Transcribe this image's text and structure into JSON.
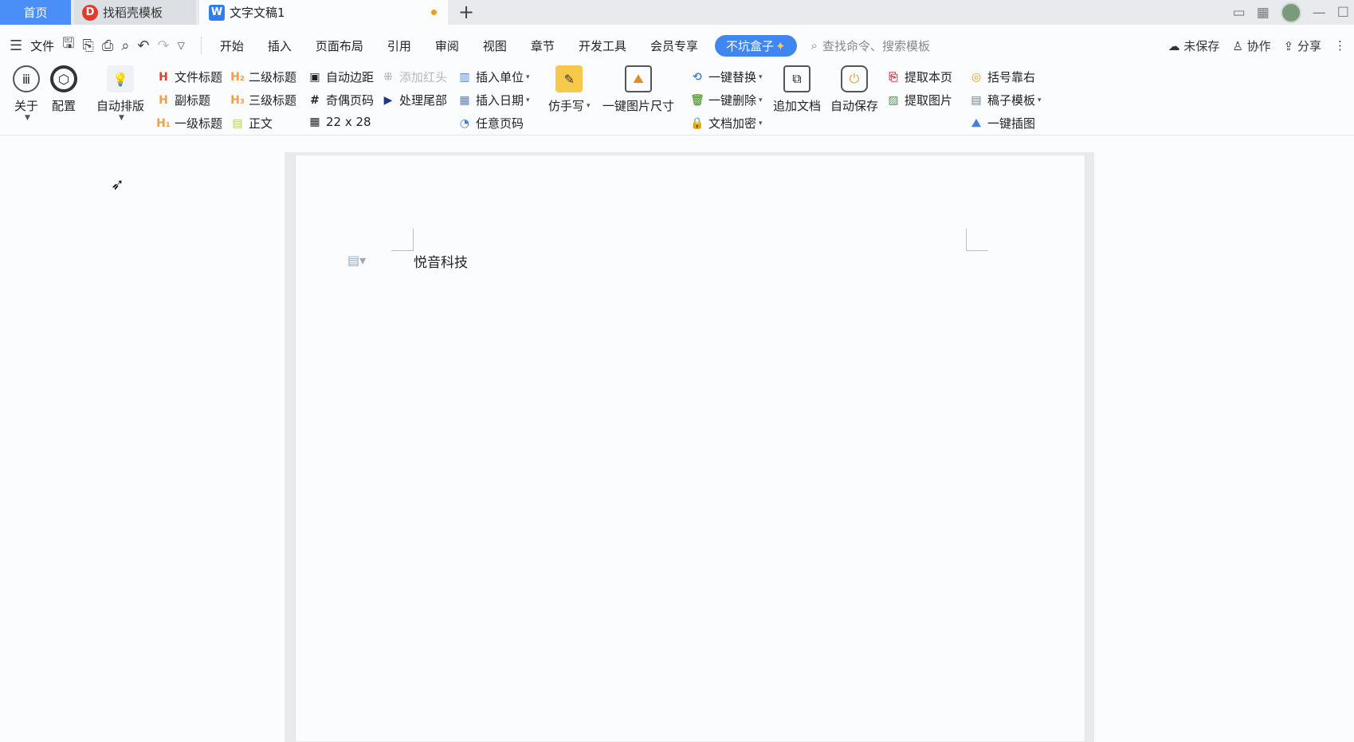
{
  "tabs": {
    "home": "首页",
    "template": "找稻壳模板",
    "document": "文字文稿1",
    "new_tab": "+"
  },
  "menu": {
    "file": "文件",
    "items": [
      "开始",
      "插入",
      "页面布局",
      "引用",
      "审阅",
      "视图",
      "章节",
      "开发工具",
      "会员专享"
    ],
    "active": "不坑盒子",
    "search_placeholder": "查找命令、搜索模板",
    "unsaved": "未保存",
    "collaborate": "协作",
    "share": "分享"
  },
  "ribbon": {
    "about": "关于",
    "config": "配置",
    "auto_layout": "自动排版",
    "doc_title": "文件标题",
    "subtitle": "副标题",
    "heading1": "一级标题",
    "heading2": "二级标题",
    "heading3": "三级标题",
    "body": "正文",
    "auto_margin": "自动边距",
    "odd_even_page": "奇偶页码",
    "grid_size": "22 x 28",
    "add_red_header": "添加红头",
    "process_tail": "处理尾部",
    "insert_unit": "插入单位",
    "insert_date": "插入日期",
    "any_page_number": "任意页码",
    "imitate_handwriting": "仿手写",
    "one_click_image_size": "一键图片尺寸",
    "one_click_replace": "一键替换",
    "one_click_delete": "一键删除",
    "doc_encrypt": "文档加密",
    "append_doc": "追加文档",
    "auto_save": "自动保存",
    "extract_page": "提取本页",
    "extract_image": "提取图片",
    "bracket_right": "括号靠右",
    "manuscript_template": "稿子模板",
    "one_click_illustration": "一键插图"
  },
  "document": {
    "text": "悦音科技"
  },
  "colors": {
    "accent": "#3f86f2",
    "home_tab": "#4a8ef7",
    "unsaved_dot": "#f29a1c"
  }
}
